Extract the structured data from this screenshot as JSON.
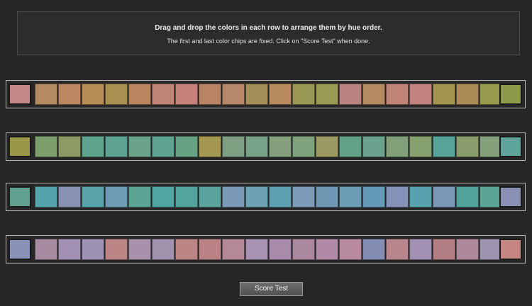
{
  "instructions": {
    "line1": "Drag and drop the colors in each row to arrange them by hue order.",
    "line2": "The first and last color chips are fixed. Click on \"Score Test\" when done."
  },
  "rows": [
    {
      "chips": [
        "#c48788",
        "#b48a62",
        "#bb8662",
        "#b68d55",
        "#a89150",
        "#b98460",
        "#c18575",
        "#c6837c",
        "#b98366",
        "#b78769",
        "#a58d57",
        "#b88c5e",
        "#999854",
        "#9a9a55",
        "#ba8380",
        "#b48a62",
        "#c18479",
        "#c3847f",
        "#a39450",
        "#ab8c56",
        "#959a4d",
        "#8e9a4b"
      ]
    },
    {
      "chips": [
        "#9a9746",
        "#7c9e6d",
        "#8c9b63",
        "#5ea38d",
        "#5ea392",
        "#6aa28a",
        "#5fa491",
        "#66a284",
        "#a39752",
        "#7ea082",
        "#78a189",
        "#86a07e",
        "#7ea37c",
        "#9b9a62",
        "#61a186",
        "#6aa28d",
        "#81a07a",
        "#86a06f",
        "#57a39a",
        "#8a9c6b",
        "#83a07b",
        "#5ea49a"
      ]
    },
    {
      "chips": [
        "#5fa08e",
        "#55a3ad",
        "#8891b2",
        "#58a4aa",
        "#6e9bb3",
        "#5aa494",
        "#4ea5a2",
        "#53a49f",
        "#5aa39d",
        "#7b9ab7",
        "#6ca2b1",
        "#5ea1b2",
        "#7e9ab9",
        "#7098b4",
        "#6b9db4",
        "#6499b7",
        "#8593b8",
        "#58a2b0",
        "#7c98b9",
        "#51a29b",
        "#5ba597",
        "#8a8fb4"
      ]
    },
    {
      "chips": [
        "#8892b8",
        "#a98ba1",
        "#a190b1",
        "#9c90b3",
        "#bc8686",
        "#a990ab",
        "#a091ad",
        "#bb8583",
        "#bc8387",
        "#b48898",
        "#a692b3",
        "#aa8aab",
        "#ac88a0",
        "#b08aa5",
        "#b78a9d",
        "#838eb2",
        "#ba868e",
        "#a291b3",
        "#b37f84",
        "#ad899a",
        "#9e92b1",
        "#c38680"
      ]
    }
  ],
  "score_button_label": "Score Test"
}
